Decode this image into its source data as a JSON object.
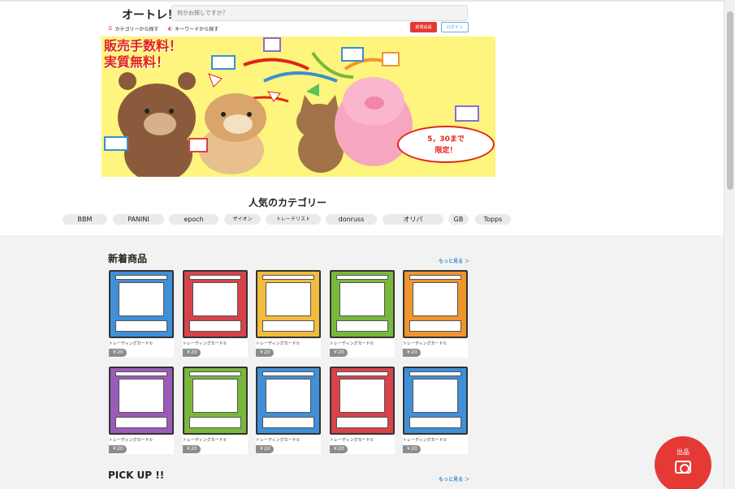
{
  "header": {
    "logo": "オートレ！",
    "search_placeholder": "何かお探しですか？",
    "nav_category": "カテゴリーから探す",
    "nav_keyword": "キーワードから探す",
    "signup": "新規会員",
    "login": "ログイン"
  },
  "banner": {
    "title_line1": "販売手数料！",
    "title_line2": "実質無料！",
    "bubble_line1": "5，30まで",
    "bubble_line2": "限定！"
  },
  "popular": {
    "title": "人気のカテゴリー",
    "categories": [
      "BBM",
      "PANINI",
      "epoch",
      "ザイオン",
      "トレードリスト",
      "donruss",
      "オリパ",
      "GB",
      "Topps"
    ]
  },
  "new_items": {
    "title": "新着商品",
    "more": "もっと見る ＞",
    "items": [
      {
        "name": "トレーディングカード①",
        "price": "￥20",
        "color": "#3f8fd9"
      },
      {
        "name": "トレーディングカード①",
        "price": "￥20",
        "color": "#d9424a"
      },
      {
        "name": "トレーディングカード①",
        "price": "￥20",
        "color": "#f2bd3d"
      },
      {
        "name": "トレーディングカード①",
        "price": "￥20",
        "color": "#7ab83d"
      },
      {
        "name": "トレーディングカード①",
        "price": "￥20",
        "color": "#f0952e"
      },
      {
        "name": "トレーディングカード①",
        "price": "￥20",
        "color": "#9a5cb8"
      },
      {
        "name": "トレーディングカード①",
        "price": "￥20",
        "color": "#7ab83d"
      },
      {
        "name": "トレーディングカード①",
        "price": "￥20",
        "color": "#3f8fd9"
      },
      {
        "name": "トレーディングカード①",
        "price": "￥20",
        "color": "#d9424a"
      },
      {
        "name": "トレーディングカード①",
        "price": "￥20",
        "color": "#3f8fd9"
      }
    ]
  },
  "pickup": {
    "title": "PICK UP !!",
    "more": "もっと見る ＞"
  },
  "fab": {
    "label": "出品",
    "icon": "camera-icon"
  }
}
